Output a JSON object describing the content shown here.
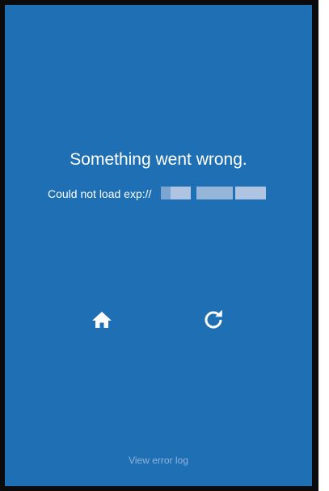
{
  "error_screen": {
    "title": "Something went wrong.",
    "message": "Could not load exp://",
    "message_suffix_redacted": true,
    "view_error_log_label": "View error log"
  },
  "actions": {
    "home_icon": "home-icon",
    "reload_icon": "reload-icon"
  },
  "colors": {
    "background": "#1f6fb5",
    "text": "#ffffff",
    "muted_link": "#8fb4dc",
    "frame": "#0b0b0b"
  }
}
